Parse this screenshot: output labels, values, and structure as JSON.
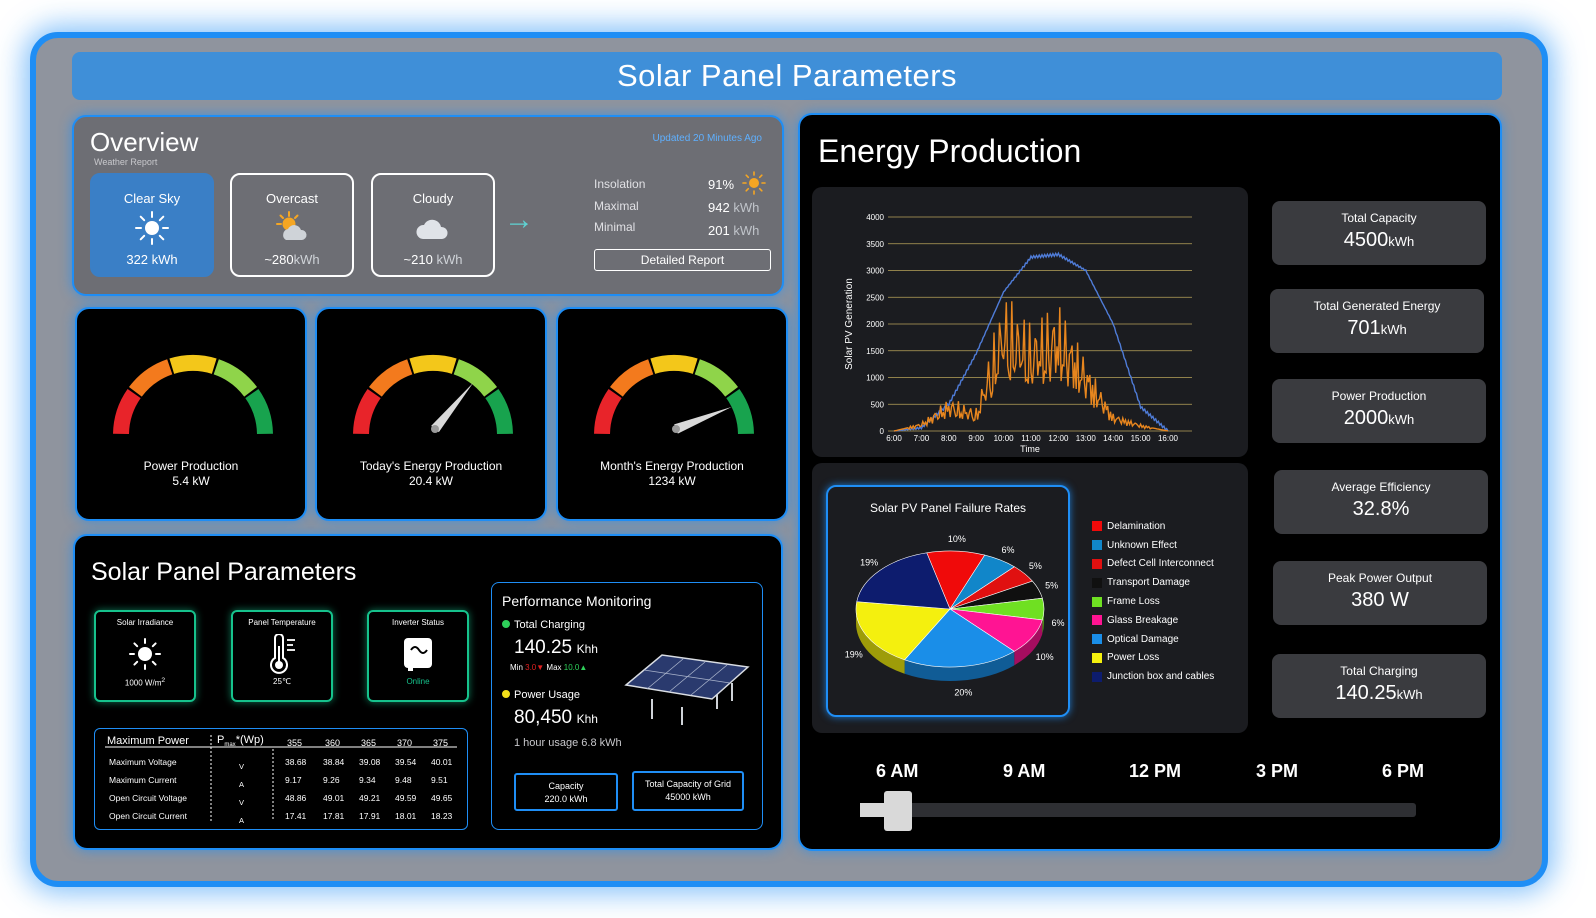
{
  "header": {
    "title": "Solar Panel Parameters"
  },
  "overview": {
    "title": "Overview",
    "subtitle": "Weather Report",
    "updated": "Updated 20 Minutes Ago",
    "cards": [
      {
        "label": "Clear Sky",
        "value": "322 kWh",
        "icon": "sun-icon"
      },
      {
        "label": "Overcast",
        "value": "~280",
        "unit": "kWh",
        "icon": "sun-cloud-icon"
      },
      {
        "label": "Cloudy",
        "value": "~210",
        "unit": "kWh",
        "icon": "cloud-icon"
      }
    ],
    "metrics": [
      {
        "label": "Insolation",
        "value": "91%"
      },
      {
        "label": "Maximal",
        "value": "942",
        "unit": "kWh"
      },
      {
        "label": "Minimal",
        "value": "201",
        "unit": "kWh"
      }
    ],
    "detailed_report": "Detailed Report"
  },
  "gauges": [
    {
      "label": "Power Production",
      "value": "5.4 kW",
      "needle": null
    },
    {
      "label": "Today's Energy Production",
      "value": "20.4 kW",
      "needle": 0.72
    },
    {
      "label": "Month's Energy Production",
      "value": "1234 kW",
      "needle": 0.88
    }
  ],
  "params": {
    "title": "Solar Panel Parameters",
    "sensors": [
      {
        "label": "Solar Irradiance",
        "value": "1000 W/m",
        "sup": "2",
        "icon": "sun-icon"
      },
      {
        "label": "Panel Temperature",
        "value": "25℃",
        "icon": "thermometer-icon"
      },
      {
        "label": "Inverter Status",
        "value": "Online",
        "icon": "inverter-icon"
      }
    ],
    "table": {
      "header": "Maximum Power",
      "pmax": "P",
      "pmax_sub": "max",
      "pmax_unit": "*(Wp)",
      "cols": [
        "355",
        "360",
        "365",
        "370",
        "375"
      ],
      "rows": [
        {
          "name": "Maximum Voltage",
          "unit": "V",
          "values": [
            "38.68",
            "38.84",
            "39.08",
            "39.54",
            "40.01"
          ]
        },
        {
          "name": "Maximum Current",
          "unit": "A",
          "values": [
            "9.17",
            "9.26",
            "9.34",
            "9.48",
            "9.51"
          ]
        },
        {
          "name": "Open Circuit Voltage",
          "unit": "V",
          "values": [
            "48.86",
            "49.01",
            "49.21",
            "49.59",
            "49.65"
          ]
        },
        {
          "name": "Open Circuit Current",
          "unit": "A",
          "values": [
            "17.41",
            "17.81",
            "17.91",
            "18.01",
            "18.23"
          ]
        }
      ]
    },
    "perf": {
      "title": "Performance Monitoring",
      "charging_label": "Total Charging",
      "charging_value": "140.25",
      "charging_unit": "Khh",
      "min_label": "Min",
      "min_value": "3.0",
      "max_label": "Max",
      "max_value": "10.0",
      "usage_label": "Power Usage",
      "usage_value": "80,450",
      "usage_unit": "Khh",
      "usage_note": "1 hour usage 6.8 kWh",
      "capacity_label": "Capacity",
      "capacity_value": "220.0 kWh",
      "grid_label": "Total Capacity of Grid",
      "grid_value": "45000 kWh"
    }
  },
  "energy": {
    "title": "Energy Production",
    "stats": [
      {
        "label": "Total Capacity",
        "value": "4500",
        "unit": "kWh"
      },
      {
        "label": "Total Generated Energy",
        "value": "701",
        "unit": "kWh"
      },
      {
        "label": "Power Production",
        "value": "2000",
        "unit": "kWh"
      },
      {
        "label": "Average Efficiency",
        "value": "32.8%",
        "unit": ""
      },
      {
        "label": "Peak Power Output",
        "value": "380 W",
        "unit": ""
      },
      {
        "label": "Total Charging",
        "value": "140.25",
        "unit": "kWh"
      }
    ],
    "timeline": [
      "6 AM",
      "9 AM",
      "12 PM",
      "3 PM",
      "6 PM"
    ],
    "timeline_position": 0.05
  },
  "chart_data": [
    {
      "type": "line",
      "title": "",
      "xlabel": "Time",
      "ylabel": "Solar PV Generation",
      "x": [
        "6:00",
        "7:00",
        "8:00",
        "9:00",
        "10:00",
        "11:00",
        "12:00",
        "13:00",
        "14:00",
        "15:00",
        "16:00"
      ],
      "ylim": [
        0,
        4000
      ],
      "yticks": [
        0,
        500,
        1000,
        1500,
        2000,
        2500,
        3000,
        3500,
        4000
      ],
      "series": [
        {
          "color": "#4f7cd8",
          "values": [
            0,
            60,
            500,
            1450,
            2600,
            3250,
            3300,
            3000,
            2000,
            450,
            0
          ]
        },
        {
          "color": "#e8861e",
          "values": [
            0,
            120,
            450,
            300,
            1800,
            1400,
            1700,
            1000,
            250,
            100,
            0
          ]
        }
      ]
    },
    {
      "type": "pie",
      "title": "Solar PV Panel Failure Rates",
      "slices": [
        {
          "name": "Delamination",
          "value": 10,
          "color": "#f00a0a"
        },
        {
          "name": "Unknown Effect",
          "value": 6,
          "color": "#1186c9"
        },
        {
          "name": "Defect Cell Interconnect",
          "value": 5,
          "color": "#e01010"
        },
        {
          "name": "Transport Damage",
          "value": 5,
          "color": "#101010"
        },
        {
          "name": "Frame Loss",
          "value": 6,
          "color": "#6fe022"
        },
        {
          "name": "Glass Breakage",
          "value": 10,
          "color": "#ff1493"
        },
        {
          "name": "Optical Damage",
          "value": 20,
          "color": "#1a8ee8"
        },
        {
          "name": "Power Loss",
          "value": 19,
          "color": "#f4f00e"
        },
        {
          "name": "Junction box and cables",
          "value": 19,
          "color": "#0d1c6e"
        }
      ],
      "labels": [
        "10%",
        "6%",
        "5%",
        "5%",
        "6%",
        "10%",
        "20%",
        "19%",
        "19%"
      ]
    }
  ]
}
